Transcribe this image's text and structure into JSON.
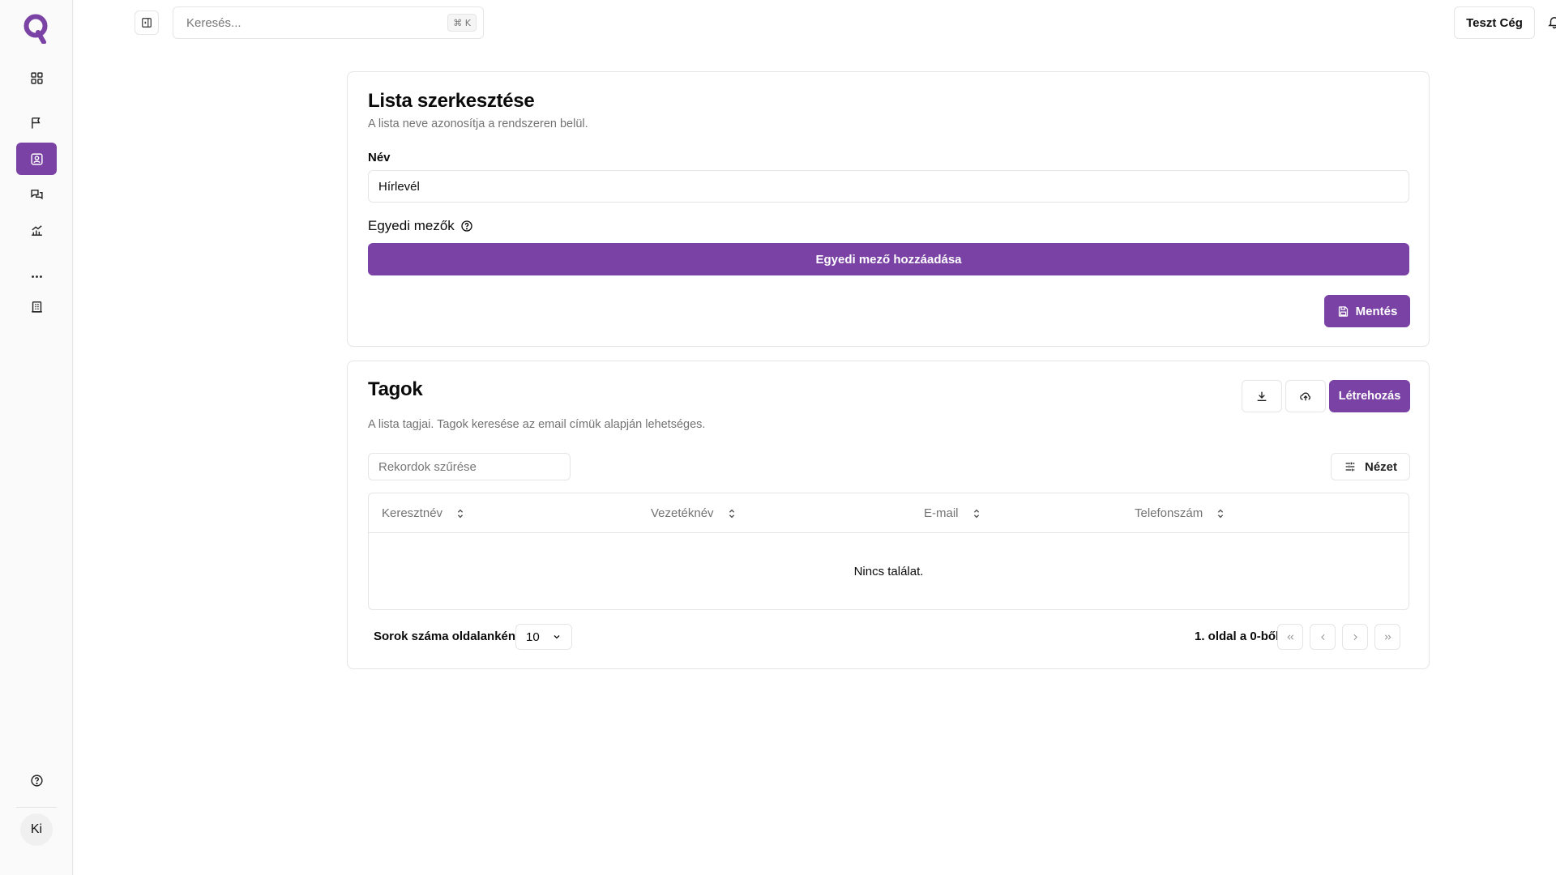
{
  "topbar": {
    "search_placeholder": "Keresés...",
    "search_shortcut": "⌘ K",
    "company_label": "Teszt Cég"
  },
  "sidebar": {
    "items": [
      {
        "name": "dashboard-icon",
        "active": false
      },
      {
        "name": "flag-icon",
        "active": false
      },
      {
        "name": "contacts-icon",
        "active": true
      },
      {
        "name": "messages-icon",
        "active": false
      },
      {
        "name": "analytics-icon",
        "active": false
      },
      {
        "name": "more-icon",
        "active": false
      },
      {
        "name": "building-icon",
        "active": false
      }
    ],
    "help_icon": "help-icon",
    "avatar_initials": "Ki"
  },
  "edit_card": {
    "title": "Lista szerkesztése",
    "description": "A lista neve azonosítja a rendszeren belül.",
    "name_label": "Név",
    "name_value": "Hírlevél",
    "custom_fields_label": "Egyedi mezők",
    "add_field_button": "Egyedi mező hozzáadása",
    "save_button": "Mentés"
  },
  "members_card": {
    "title": "Tagok",
    "description": "A lista tagjai. Tagok keresése az email címük alapján lehetséges.",
    "create_button": "Létrehozás",
    "filter_placeholder": "Rekordok szűrése",
    "view_button": "Nézet",
    "columns": [
      "Keresztnév",
      "Vezetéknév",
      "E-mail",
      "Telefonszám"
    ],
    "empty_text": "Nincs találat.",
    "rows_per_page_label": "Sorok száma oldalanként",
    "rows_per_page_value": "10",
    "page_info": "1. oldal a 0-ből"
  },
  "colors": {
    "accent": "#7a42a4",
    "border": "#e5e5e5",
    "muted_text": "#737373"
  }
}
